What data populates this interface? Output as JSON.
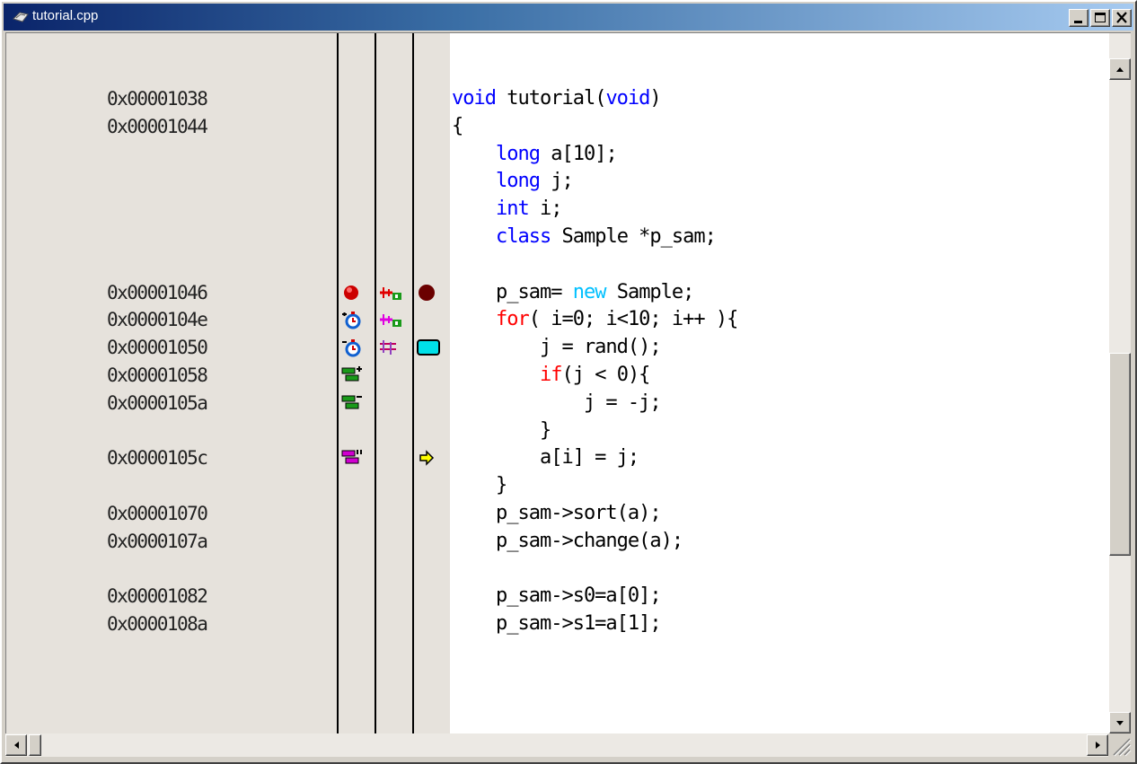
{
  "window": {
    "title": "tutorial.cpp"
  },
  "icons": {
    "title": "document-icon",
    "minimize": "minimize-icon",
    "maximize": "maximize-icon",
    "close": "close-icon"
  },
  "colors": {
    "keyword": "#0000ff",
    "new_keyword": "#00c0ff",
    "flow_keyword": "#ff0000",
    "breakpoint": "#cc0000",
    "bookmark": "#6b0000",
    "cyan_marker": "#00e0e8",
    "pc_arrow": "#ffff00"
  },
  "lines": [
    {
      "addr": "0x00001038",
      "code": [
        [
          "kw",
          "void"
        ],
        [
          "n",
          " tutorial("
        ],
        [
          "kw",
          "void"
        ],
        [
          "n",
          ")"
        ]
      ]
    },
    {
      "addr": "0x00001044",
      "code": [
        [
          "n",
          "{"
        ]
      ]
    },
    {
      "addr": "",
      "code": [
        [
          "n",
          "    "
        ],
        [
          "kw",
          "long"
        ],
        [
          "n",
          " a[10];"
        ]
      ]
    },
    {
      "addr": "",
      "code": [
        [
          "n",
          "    "
        ],
        [
          "kw",
          "long"
        ],
        [
          "n",
          " j;"
        ]
      ]
    },
    {
      "addr": "",
      "code": [
        [
          "n",
          "    "
        ],
        [
          "kw",
          "int"
        ],
        [
          "n",
          " i;"
        ]
      ]
    },
    {
      "addr": "",
      "code": [
        [
          "n",
          "    "
        ],
        [
          "kw",
          "class"
        ],
        [
          "n",
          " Sample *p_sam;"
        ]
      ]
    },
    {
      "addr": "",
      "code": []
    },
    {
      "addr": "0x00001046",
      "code": [
        [
          "n",
          "    p_sam= "
        ],
        [
          "kwc",
          "new"
        ],
        [
          "n",
          " Sample;"
        ]
      ]
    },
    {
      "addr": "0x0000104e",
      "code": [
        [
          "n",
          "    "
        ],
        [
          "kwr",
          "for"
        ],
        [
          "n",
          "( i=0; i<10; i++ ){"
        ]
      ]
    },
    {
      "addr": "0x00001050",
      "code": [
        [
          "n",
          "        j = rand();"
        ]
      ]
    },
    {
      "addr": "0x00001058",
      "code": [
        [
          "n",
          "        "
        ],
        [
          "kwr",
          "if"
        ],
        [
          "n",
          "(j < 0){"
        ]
      ]
    },
    {
      "addr": "0x0000105a",
      "code": [
        [
          "n",
          "            j = -j;"
        ]
      ]
    },
    {
      "addr": "",
      "code": [
        [
          "n",
          "        }"
        ]
      ]
    },
    {
      "addr": "0x0000105c",
      "code": [
        [
          "n",
          "        a[i] = j;"
        ]
      ]
    },
    {
      "addr": "",
      "code": [
        [
          "n",
          "    }"
        ]
      ]
    },
    {
      "addr": "0x00001070",
      "code": [
        [
          "n",
          "    p_sam->sort(a);"
        ]
      ]
    },
    {
      "addr": "0x0000107a",
      "code": [
        [
          "n",
          "    p_sam->change(a);"
        ]
      ]
    },
    {
      "addr": "",
      "code": []
    },
    {
      "addr": "0x00001082",
      "code": [
        [
          "n",
          "    p_sam->s0=a[0];"
        ]
      ]
    },
    {
      "addr": "0x0000108a",
      "code": [
        [
          "n",
          "    p_sam->s1=a[1];"
        ]
      ]
    }
  ],
  "markers": [
    {
      "line": 7,
      "col": 1,
      "icon": "breakpoint-icon"
    },
    {
      "line": 7,
      "col": 2,
      "icon": "event-point-icon"
    },
    {
      "line": 7,
      "col": 3,
      "icon": "bookmark-dot-icon"
    },
    {
      "line": 8,
      "col": 1,
      "icon": "timer-start-icon"
    },
    {
      "line": 8,
      "col": 2,
      "icon": "event-point-magenta-icon"
    },
    {
      "line": 9,
      "col": 1,
      "icon": "timer-end-icon"
    },
    {
      "line": 9,
      "col": 2,
      "icon": "trace-point-icon"
    },
    {
      "line": 9,
      "col": 3,
      "icon": "cyan-box-icon"
    },
    {
      "line": 10,
      "col": 1,
      "icon": "trace-start-icon"
    },
    {
      "line": 11,
      "col": 1,
      "icon": "trace-end-icon"
    },
    {
      "line": 13,
      "col": 1,
      "icon": "trace-point-magenta-icon"
    },
    {
      "line": 13,
      "col": 3,
      "icon": "pc-arrow-icon"
    }
  ],
  "scrollbars": {
    "up": "scroll-up-arrow-icon",
    "down": "scroll-down-arrow-icon",
    "left": "scroll-left-arrow-icon",
    "right": "scroll-right-arrow-icon",
    "grip": "resize-grip-icon"
  }
}
